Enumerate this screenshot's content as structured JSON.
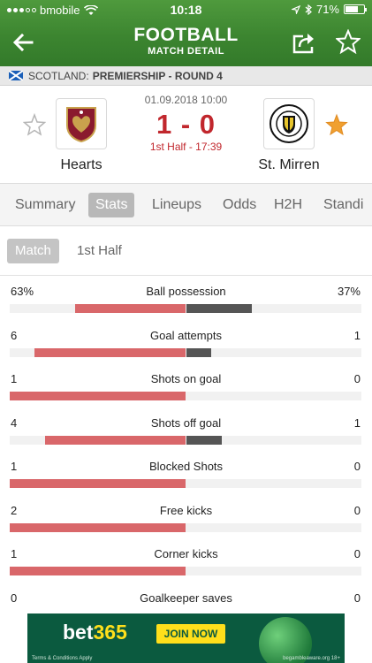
{
  "status_bar": {
    "carrier": "bmobile",
    "time": "10:18",
    "battery": "71%"
  },
  "header": {
    "title": "FOOTBALL",
    "subtitle": "MATCH DETAIL"
  },
  "league": {
    "country": "SCOTLAND:",
    "name": "PREMIERSHIP - ROUND 4"
  },
  "match": {
    "date": "01.09.2018 10:00",
    "score": "1 - 0",
    "status": "1st Half - 17:39",
    "home_team": "Hearts",
    "away_team": "St. Mirren",
    "home_favorite": false,
    "away_favorite": true
  },
  "tabs": [
    "Summary",
    "Stats",
    "Lineups",
    "Odds",
    "H2H",
    "Standi"
  ],
  "active_tab": "Stats",
  "subtabs": [
    "Match",
    "1st Half"
  ],
  "active_subtab": "Match",
  "stats": [
    {
      "label": "Ball possession",
      "home": "63%",
      "away": "37%",
      "home_fraction": 0.63,
      "away_fraction": 0.37
    },
    {
      "label": "Goal attempts",
      "home": "6",
      "away": "1",
      "home_fraction": 0.857,
      "away_fraction": 0.143
    },
    {
      "label": "Shots on goal",
      "home": "1",
      "away": "0",
      "home_fraction": 1.0,
      "away_fraction": 0.0
    },
    {
      "label": "Shots off goal",
      "home": "4",
      "away": "1",
      "home_fraction": 0.8,
      "away_fraction": 0.2
    },
    {
      "label": "Blocked Shots",
      "home": "1",
      "away": "0",
      "home_fraction": 1.0,
      "away_fraction": 0.0
    },
    {
      "label": "Free kicks",
      "home": "2",
      "away": "0",
      "home_fraction": 1.0,
      "away_fraction": 0.0
    },
    {
      "label": "Corner kicks",
      "home": "1",
      "away": "0",
      "home_fraction": 1.0,
      "away_fraction": 0.0
    },
    {
      "label": "Goalkeeper saves",
      "home": "0",
      "away": "0",
      "home_fraction": 0.0,
      "away_fraction": 0.0
    }
  ],
  "ad": {
    "brand_part1": "bet",
    "brand_part2": "365",
    "cta": "JOIN NOW",
    "small_left": "Terms & Conditions Apply",
    "small_right": "begambleaware.org 18+"
  },
  "colors": {
    "header_green": "#3c8530",
    "score_red": "#c1272d",
    "home_bar": "#d9676a",
    "away_bar": "#555555",
    "fav_orange": "#f0a030"
  }
}
